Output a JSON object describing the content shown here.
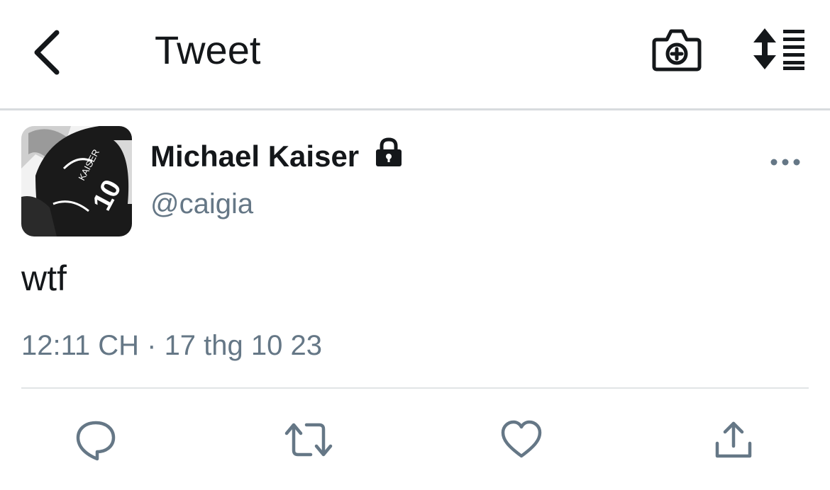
{
  "header": {
    "back_icon": "chevron-left-icon",
    "title": "Tweet",
    "camera_icon": "camera-plus-icon",
    "sort_icon": "sort-list-icon"
  },
  "tweet": {
    "author": {
      "name": "Michael Kaiser",
      "handle": "@caigia",
      "protected_icon": "lock-icon",
      "avatar": {
        "description_icon": "avatar-image",
        "jersey_text": "KAISER",
        "jersey_number": "10"
      }
    },
    "more_icon": "more-horizontal-icon",
    "text": "wtf",
    "meta": "12:11 CH · 17 thg 10 23"
  },
  "actions": [
    {
      "name": "reply",
      "icon": "reply-icon"
    },
    {
      "name": "retweet",
      "icon": "retweet-icon"
    },
    {
      "name": "like",
      "icon": "heart-icon"
    },
    {
      "name": "share",
      "icon": "share-icon"
    }
  ],
  "colors": {
    "text_primary": "#14171a",
    "text_secondary": "#657786",
    "divider": "#e1e4e6"
  }
}
